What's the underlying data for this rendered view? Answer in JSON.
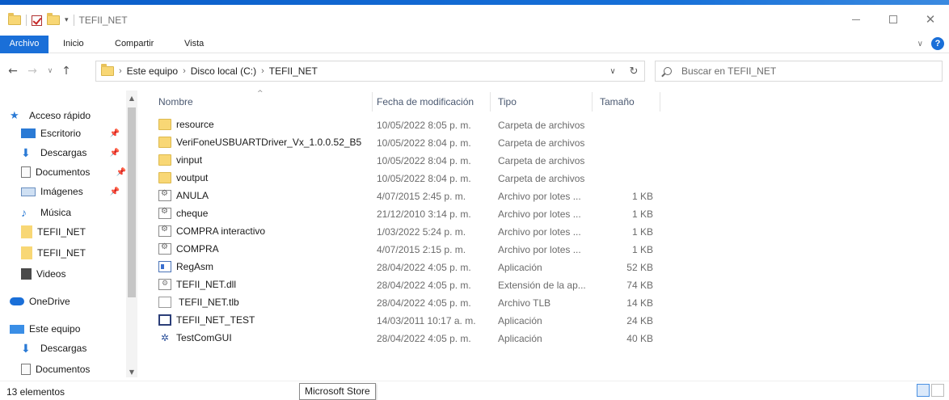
{
  "window": {
    "title": "TEFII_NET",
    "accent_color": "#1a6fd8"
  },
  "ribbon": {
    "tabs": [
      "Archivo",
      "Inicio",
      "Compartir",
      "Vista"
    ],
    "help_label": "?"
  },
  "navigation": {
    "breadcrumb": [
      "Este equipo",
      "Disco local (C:)",
      "TEFII_NET"
    ],
    "search_placeholder": "Buscar en TEFII_NET"
  },
  "sidebar": {
    "quick_access": "Acceso rápido",
    "items": [
      {
        "label": "Escritorio",
        "icon": "desktop-icon",
        "pinned": true
      },
      {
        "label": "Descargas",
        "icon": "download-icon",
        "pinned": true
      },
      {
        "label": "Documentos",
        "icon": "documents-icon",
        "pinned": true
      },
      {
        "label": "Imágenes",
        "icon": "pictures-icon",
        "pinned": true
      },
      {
        "label": "Música",
        "icon": "music-icon",
        "pinned": false
      },
      {
        "label": "TEFII_NET",
        "icon": "folder-icon",
        "pinned": false
      },
      {
        "label": "TEFII_NET",
        "icon": "folder-icon",
        "pinned": false
      },
      {
        "label": "Videos",
        "icon": "videos-icon",
        "pinned": false
      }
    ],
    "onedrive": "OneDrive",
    "this_pc": "Este equipo",
    "pc_items": [
      {
        "label": "Descargas",
        "icon": "download-icon"
      },
      {
        "label": "Documentos",
        "icon": "documents-icon"
      }
    ]
  },
  "file_list": {
    "columns": [
      "Nombre",
      "Fecha de modificación",
      "Tipo",
      "Tamaño"
    ],
    "rows": [
      {
        "name": "resource",
        "date": "10/05/2022 8:05 p. m.",
        "type": "Carpeta de archivos",
        "size": "",
        "icon": "folder-icon"
      },
      {
        "name": "VeriFoneUSBUARTDriver_Vx_1.0.0.52_B5",
        "date": "10/05/2022 8:04 p. m.",
        "type": "Carpeta de archivos",
        "size": "",
        "icon": "folder-icon"
      },
      {
        "name": "vinput",
        "date": "10/05/2022 8:04 p. m.",
        "type": "Carpeta de archivos",
        "size": "",
        "icon": "folder-icon"
      },
      {
        "name": "voutput",
        "date": "10/05/2022 8:04 p. m.",
        "type": "Carpeta de archivos",
        "size": "",
        "icon": "folder-icon"
      },
      {
        "name": "ANULA",
        "date": "4/07/2015 2:45 p. m.",
        "type": "Archivo por lotes ...",
        "size": "1 KB",
        "icon": "batch-file-icon"
      },
      {
        "name": "cheque",
        "date": "21/12/2010 3:14 p. m.",
        "type": "Archivo por lotes ...",
        "size": "1 KB",
        "icon": "batch-file-icon"
      },
      {
        "name": "COMPRA interactivo",
        "date": "1/03/2022 5:24 p. m.",
        "type": "Archivo por lotes ...",
        "size": "1 KB",
        "icon": "batch-file-icon"
      },
      {
        "name": "COMPRA",
        "date": "4/07/2015 2:15 p. m.",
        "type": "Archivo por lotes ...",
        "size": "1 KB",
        "icon": "batch-file-icon"
      },
      {
        "name": "RegAsm",
        "date": "28/04/2022 4:05 p. m.",
        "type": "Aplicación",
        "size": "52 KB",
        "icon": "application-icon"
      },
      {
        "name": "TEFII_NET.dll",
        "date": "28/04/2022 4:05 p. m.",
        "type": "Extensión de la ap...",
        "size": "74 KB",
        "icon": "dll-file-icon"
      },
      {
        "name": "TEFII_NET.tlb",
        "date": "28/04/2022 4:05 p. m.",
        "type": "Archivo TLB",
        "size": "14 KB",
        "icon": "generic-file-icon"
      },
      {
        "name": "TEFII_NET_TEST",
        "date": "14/03/2011 10:17 a. m.",
        "type": "Aplicación",
        "size": "24 KB",
        "icon": "window-app-icon"
      },
      {
        "name": "TestComGUI",
        "date": "28/04/2022 4:05 p. m.",
        "type": "Aplicación",
        "size": "40 KB",
        "icon": "gui-app-icon"
      }
    ]
  },
  "status": {
    "count": "13 elementos",
    "tooltip": "Microsoft Store"
  }
}
